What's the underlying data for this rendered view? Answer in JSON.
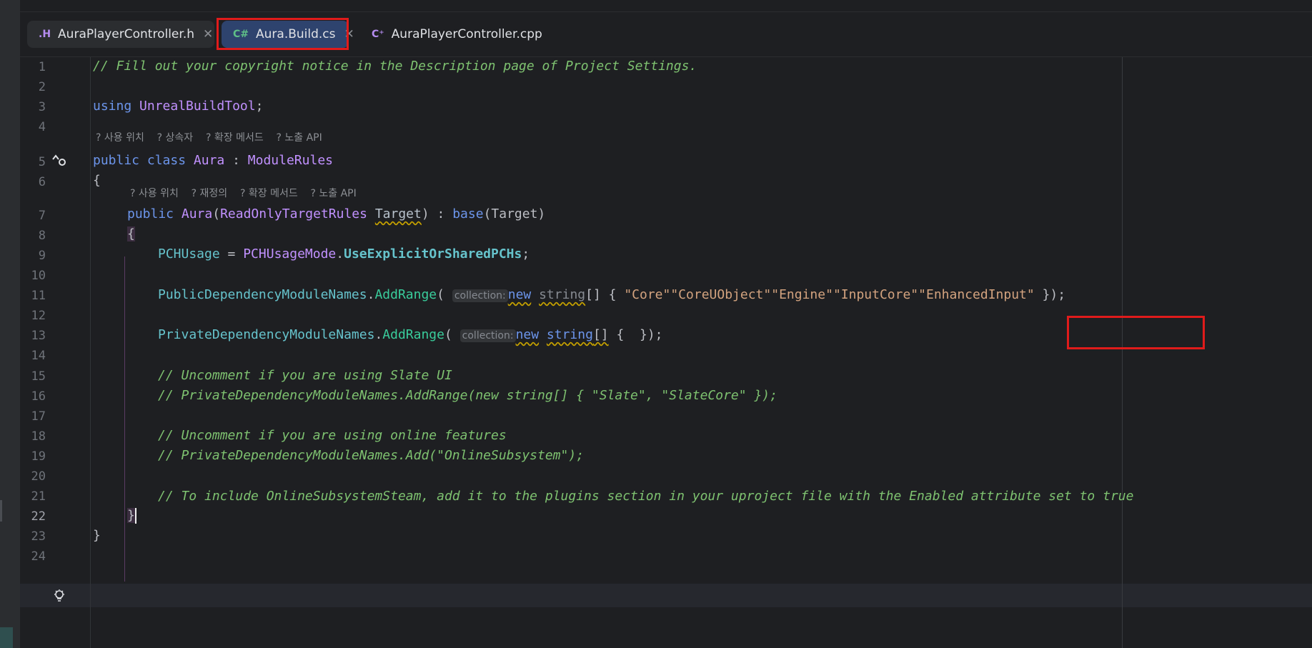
{
  "tabs": [
    {
      "icon": ".H",
      "label": "AuraPlayerController.h",
      "close": "✕"
    },
    {
      "icon": "C#",
      "label": "Aura.Build.cs",
      "close": "✕"
    },
    {
      "icon": "C⁺",
      "label": "AuraPlayerController.cpp"
    }
  ],
  "line_numbers": [
    "1",
    "2",
    "3",
    "4",
    "5",
    "6",
    "7",
    "8",
    "9",
    "10",
    "11",
    "12",
    "13",
    "14",
    "15",
    "16",
    "17",
    "18",
    "19",
    "20",
    "21",
    "22",
    "23",
    "24"
  ],
  "current_line": "22",
  "hints": {
    "class_hint": "? 사용 위치    ? 상속자    ? 확장 메서드    ? 노출 API",
    "ctor_hint": "? 사용 위치    ? 재정의    ? 확장 메서드    ? 노출 API"
  },
  "inlay_collection": "collection:",
  "code": {
    "l1": "// Fill out your copyright notice in the Description page of Project Settings.",
    "l3_kw": "using",
    "l3_ns": "UnrealBuildTool",
    "l3_end": ";",
    "l5_kw1": "public",
    "l5_kw2": "class",
    "l5_cls": "Aura",
    "l5_colon": " : ",
    "l5_base": "ModuleRules",
    "l6": "{",
    "l7_kw": "public",
    "l7_name": "Aura",
    "l7_paren": "(",
    "l7_type": "ReadOnlyTargetRules",
    "l7_param": "Target",
    "l7_mid": ") : ",
    "l7_base": "base",
    "l7_end": "(Target)",
    "l8": "{",
    "l9_prop": "PCHUsage",
    "l9_eq": " = ",
    "l9_type": "PCHUsageMode",
    "l9_dot": ".",
    "l9_val": "UseExplicitOrSharedPCHs",
    "l9_end": ";",
    "l11_prop": "PublicDependencyModuleNames",
    "l11_dot": ".",
    "l11_fn": "AddRange",
    "l11_paren": "(",
    "l11_new": "new",
    "l11_type": "string",
    "l11_arr": "[] { ",
    "l11_s1": "\"Core\"",
    "l11_s2": "\"CoreUObject\"",
    "l11_s3": "\"Engine\"",
    "l11_s4": "\"InputCore\"",
    "l11_s5": "\"EnhancedInput\"",
    "comma": ", ",
    "l11_end": " });",
    "l13_prop": "PrivateDependencyModuleNames",
    "l13_dot": ".",
    "l13_fn": "AddRange",
    "l13_paren": "(",
    "l13_new": "new",
    "l13_type": "string",
    "l13_arr": "[]",
    "l13_end": " {  });",
    "l15": "// Uncomment if you are using Slate UI",
    "l16": "// PrivateDependencyModuleNames.AddRange(new string[] { \"Slate\", \"SlateCore\" });",
    "l18": "// Uncomment if you are using online features",
    "l19": "// PrivateDependencyModuleNames.Add(\"OnlineSubsystem\");",
    "l21": "// To include OnlineSubsystemSteam, add it to the plugins section in your uproject file with the Enabled attribute set to true",
    "l22": "}",
    "l23": "}"
  },
  "gutter_icons": {
    "line5": "implements-override-icon",
    "line22": "lightbulb-icon"
  },
  "colors": {
    "background": "#1e1f22",
    "highlight_box": "#e01b1b",
    "active_tab": "#2e436e",
    "comment": "#7ec270",
    "keyword": "#6c95eb",
    "string": "#d3a37f"
  }
}
